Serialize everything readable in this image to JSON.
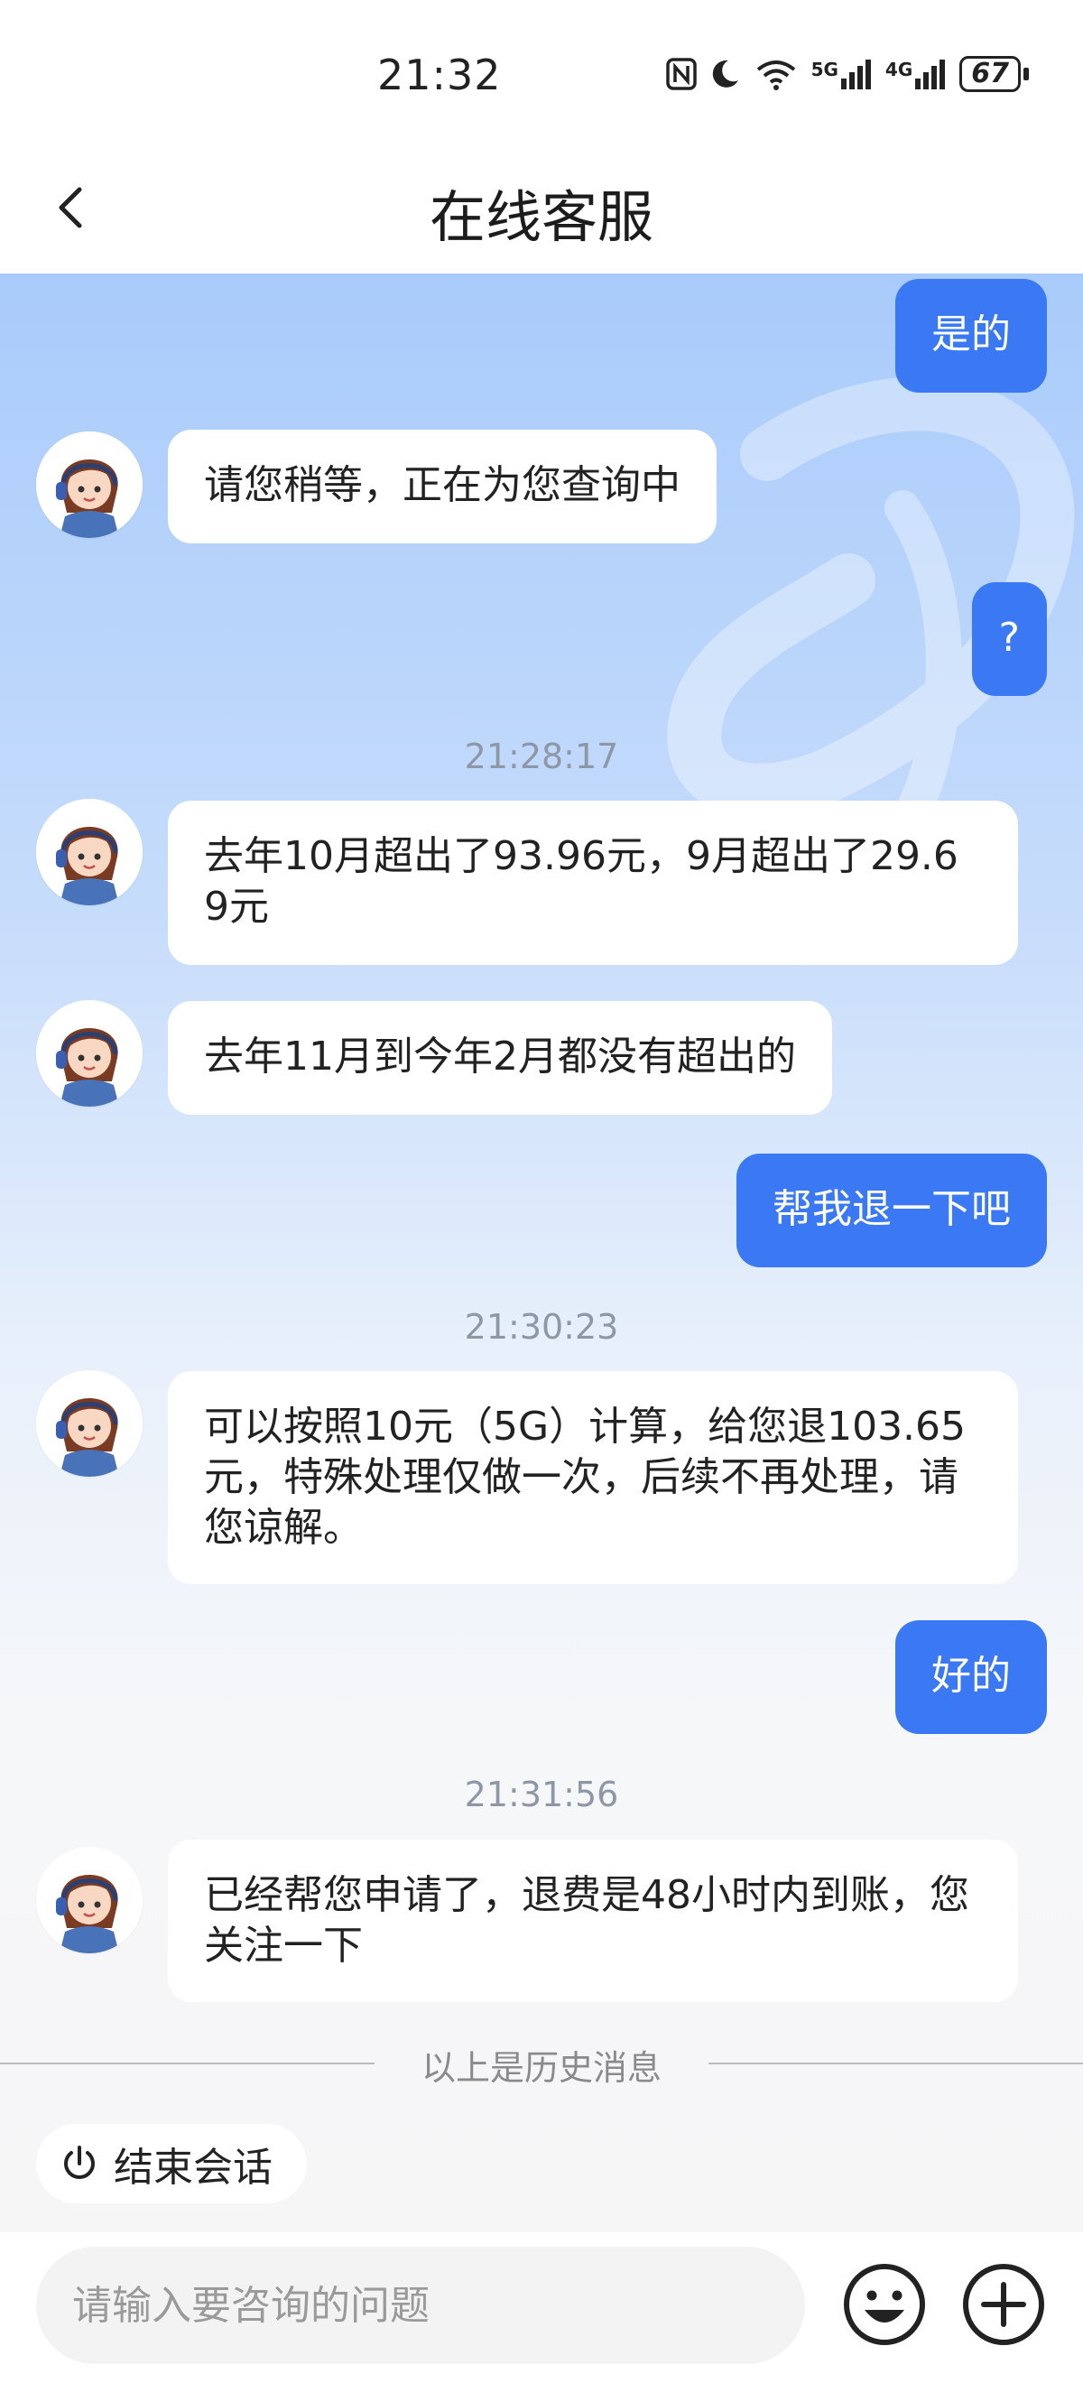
{
  "status_bar": {
    "time": "21:32",
    "icons": [
      "nfc-icon",
      "moon-icon",
      "wifi-icon",
      "5g-signal-icon",
      "4g-signal-icon"
    ],
    "net1": "5G",
    "net2": "4G",
    "battery": "67"
  },
  "header": {
    "title": "在线客服",
    "back_icon": "chevron-left-icon"
  },
  "messages": [
    {
      "sender": "user",
      "text": "是的"
    },
    {
      "sender": "agent",
      "text": "请您稍等，正在为您查询中"
    },
    {
      "sender": "user",
      "text": "?"
    },
    {
      "sender": "timestamp",
      "text": "21:28:17"
    },
    {
      "sender": "agent",
      "text": "去年10月超出了93.96元，9月超出了29.69元"
    },
    {
      "sender": "agent",
      "text": "去年11月到今年2月都没有超出的"
    },
    {
      "sender": "user",
      "text": "帮我退一下吧"
    },
    {
      "sender": "timestamp",
      "text": "21:30:23"
    },
    {
      "sender": "agent",
      "text": "可以按照10元（5G）计算，给您退103.65元，特殊处理仅做一次，后续不再处理，请您谅解。"
    },
    {
      "sender": "user",
      "text": "好的"
    },
    {
      "sender": "timestamp",
      "text": "21:31:56"
    },
    {
      "sender": "agent",
      "text": "已经帮您申请了，退费是48小时内到账，您关注一下"
    }
  ],
  "history_divider": "以上是历史消息",
  "end_session": {
    "label": "结束会话",
    "icon": "power-icon"
  },
  "input": {
    "placeholder": "请输入要咨询的问题",
    "emoji_icon": "emoji-icon",
    "plus_icon": "plus-icon"
  },
  "colors": {
    "user_bubble": "#3a79f3",
    "agent_bubble": "#ffffff",
    "timestamp": "#8e97a6"
  }
}
